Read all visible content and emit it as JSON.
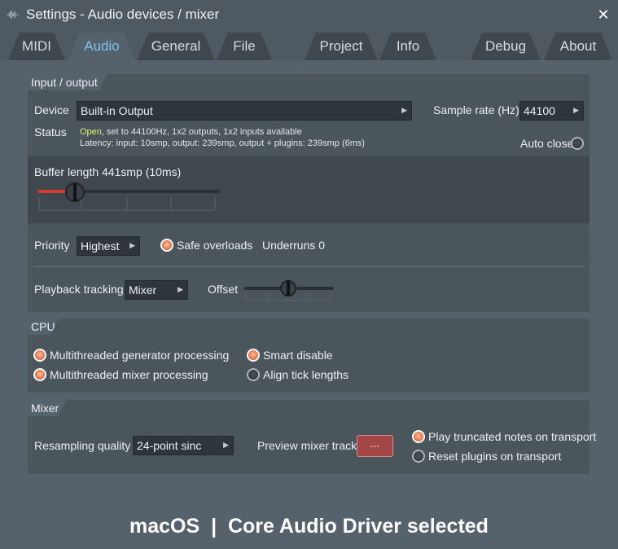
{
  "window": {
    "title": "Settings - Audio devices / mixer",
    "close_glyph": "✕"
  },
  "tabs": [
    {
      "label": "MIDI",
      "active": false
    },
    {
      "label": "Audio",
      "active": true
    },
    {
      "label": "General",
      "active": false
    },
    {
      "label": "File",
      "active": false
    },
    {
      "label": "Project",
      "active": false
    },
    {
      "label": "Info",
      "active": false
    },
    {
      "label": "Debug",
      "active": false
    },
    {
      "label": "About",
      "active": false
    }
  ],
  "io": {
    "header": "Input / output",
    "device_label": "Device",
    "device_value": "Built-in Output",
    "sample_rate_label": "Sample rate (Hz)",
    "sample_rate_value": "44100",
    "status_label": "Status",
    "status_open": "Open",
    "status_rest": ", set to 44100Hz, 1x2 outputs, 1x2 inputs available",
    "status_latency": "Latency: input: 10smp, output: 239smp, output + plugins: 239smp (6ms)",
    "auto_close_label": "Auto close",
    "auto_close_on": false,
    "buffer_label": "Buffer length 441smp (10ms)",
    "priority_label": "Priority",
    "priority_value": "Highest",
    "safe_overloads_label": "Safe overloads",
    "safe_overloads_on": true,
    "underruns_label": "Underruns 0",
    "playback_tracking_label": "Playback tracking",
    "playback_tracking_value": "Mixer",
    "offset_label": "Offset"
  },
  "cpu": {
    "header": "CPU",
    "options": [
      {
        "label": "Multithreaded generator processing",
        "on": true
      },
      {
        "label": "Multithreaded mixer processing",
        "on": true
      },
      {
        "label": "Smart disable",
        "on": true
      },
      {
        "label": "Align tick lengths",
        "on": false
      }
    ]
  },
  "mixer": {
    "header": "Mixer",
    "resampling_label": "Resampling quality",
    "resampling_value": "24-point sinc",
    "preview_label": "Preview mixer track",
    "preview_value": "---",
    "play_truncated_label": "Play truncated notes on transport",
    "play_truncated_on": true,
    "reset_plugins_label": "Reset plugins on transport",
    "reset_plugins_on": false
  },
  "caption": "macOS  |  Core Audio Driver selected",
  "colors": {
    "accent": "#7dc3ef",
    "radio_on": "#f58a60",
    "status_open": "#dff06a",
    "preview_button": "#a24648"
  }
}
